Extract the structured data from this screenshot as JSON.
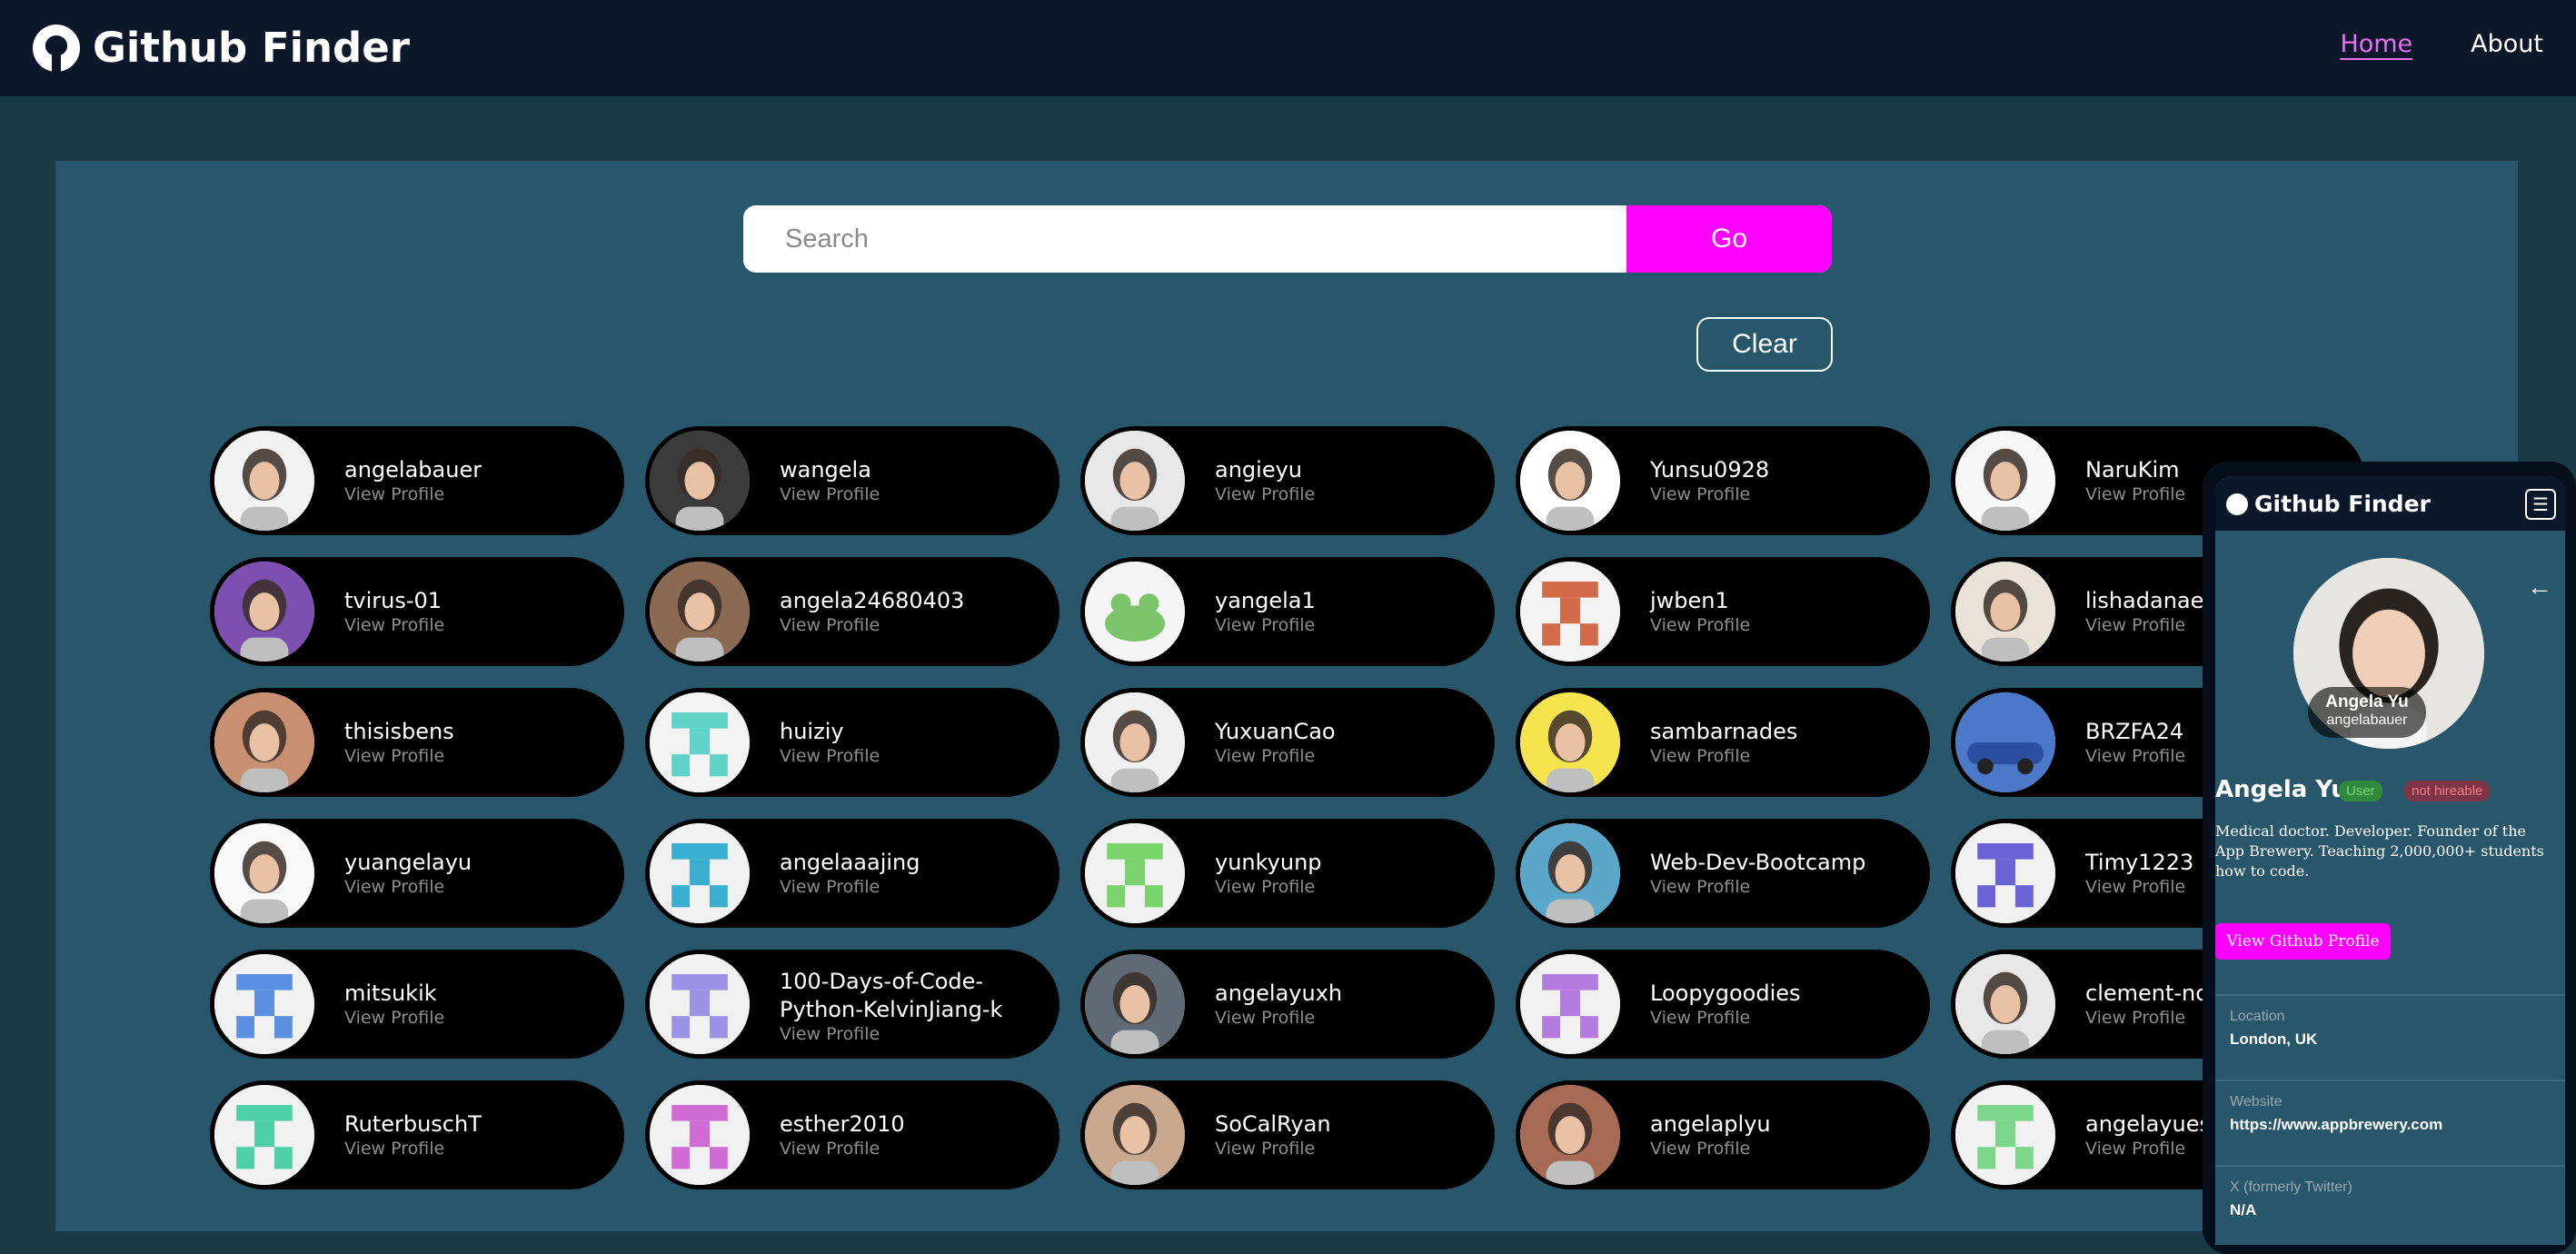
{
  "nav": {
    "brand": "Github Finder",
    "links": [
      {
        "label": "Home"
      },
      {
        "label": "About"
      }
    ]
  },
  "search": {
    "placeholder": "Search",
    "value": "",
    "go_label": "Go",
    "clear_label": "Clear"
  },
  "users": [
    {
      "login": "angelabauer",
      "view": "View Profile"
    },
    {
      "login": "wangela",
      "view": "View Profile"
    },
    {
      "login": "angieyu",
      "view": "View Profile"
    },
    {
      "login": "Yunsu0928",
      "view": "View Profile"
    },
    {
      "login": "NaruKim",
      "view": "View Profile"
    },
    {
      "login": "tvirus-01",
      "view": "View Profile"
    },
    {
      "login": "angela24680403",
      "view": "View Profile"
    },
    {
      "login": "yangela1",
      "view": "View Profile"
    },
    {
      "login": "jwben1",
      "view": "View Profile"
    },
    {
      "login": "lishadanae",
      "view": "View Profile"
    },
    {
      "login": "thisisbens",
      "view": "View Profile"
    },
    {
      "login": "huiziy",
      "view": "View Profile"
    },
    {
      "login": "YuxuanCao",
      "view": "View Profile"
    },
    {
      "login": "sambarnades",
      "view": "View Profile"
    },
    {
      "login": "BRZFA24",
      "view": "View Profile"
    },
    {
      "login": "yuangelayu",
      "view": "View Profile"
    },
    {
      "login": "angelaaajing",
      "view": "View Profile"
    },
    {
      "login": "yunkyunp",
      "view": "View Profile"
    },
    {
      "login": "Web-Dev-Bootcamp",
      "view": "View Profile"
    },
    {
      "login": "Timy1223",
      "view": "View Profile"
    },
    {
      "login": "mitsukik",
      "view": "View Profile"
    },
    {
      "login": "100-Days-of-Code-Python-KelvinJiang-k",
      "view": "View Profile"
    },
    {
      "login": "angelayuxh",
      "view": "View Profile"
    },
    {
      "login": "Loopygoodies",
      "view": "View Profile"
    },
    {
      "login": "clement-nc",
      "view": "View Profile"
    },
    {
      "login": "RuterbuschT",
      "view": "View Profile"
    },
    {
      "login": "esther2010",
      "view": "View Profile"
    },
    {
      "login": "SoCalRyan",
      "view": "View Profile"
    },
    {
      "login": "angelaplyu",
      "view": "View Profile"
    },
    {
      "login": "angelayuesa",
      "view": "View Profile"
    }
  ],
  "mobile": {
    "brand": "Github Finder",
    "menu_icon": "hamburger-icon",
    "back_icon": "arrow-left-icon",
    "avatar_name": "Angela Yu",
    "avatar_login": "angelabauer",
    "name": "Angela Yu",
    "type_badge": "User",
    "hireable_badge": "not hireable",
    "bio": "Medical doctor. Developer. Founder of the App Brewery. Teaching 2,000,000+ students how to code.",
    "profile_button": "View Github Profile",
    "location_label": "Location",
    "location": "London, UK",
    "website_label": "Website",
    "website": "https://www.appbrewery.com",
    "twitter_label": "X (formerly Twitter)",
    "twitter": "N/A"
  },
  "colors": {
    "accent": "#ff00ff",
    "nav_bg": "#0c1729",
    "panel_bg": "#28566a",
    "page_bg": "#1b3a47",
    "card_bg": "#000000"
  }
}
